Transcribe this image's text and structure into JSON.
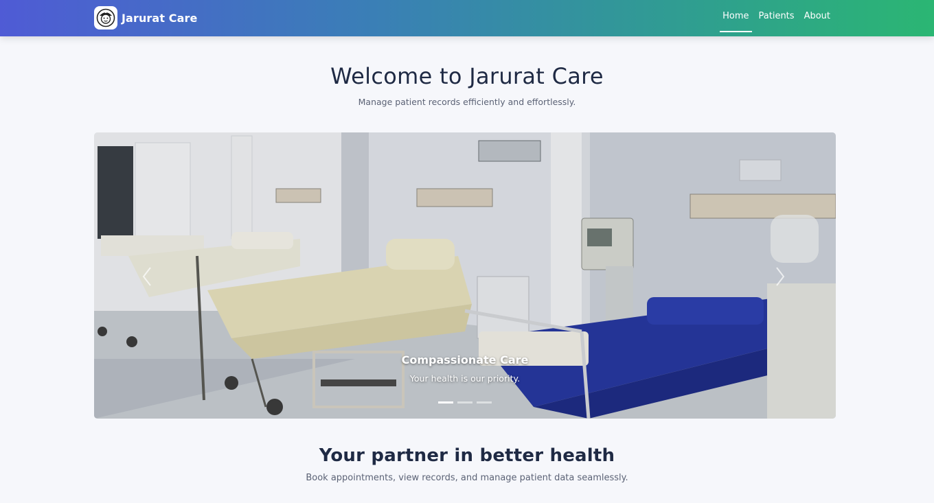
{
  "navbar": {
    "brand_name": "Jarurat Care",
    "brand_logo_icon": "doctor-face-icon",
    "links": [
      {
        "label": "Home",
        "active": true
      },
      {
        "label": "Patients",
        "active": false
      },
      {
        "label": "About",
        "active": false
      }
    ],
    "gradient_colors": [
      "#4f5bd5",
      "#2bb673"
    ]
  },
  "hero": {
    "title": "Welcome to Jarurat Care",
    "subtitle": "Manage patient records efficiently and effortlessly."
  },
  "carousel": {
    "image_icon": "hospital-ward-photo",
    "caption_title": "Compassionate Care",
    "caption_text": "Your health is our priority.",
    "slide_count": 3,
    "active_slide": 1,
    "prev_icon": "chevron-left-icon",
    "next_icon": "chevron-right-icon"
  },
  "section": {
    "title": "Your partner in better health",
    "subtitle": "Book appointments, view records, and manage patient data seamlessly."
  },
  "colors": {
    "background": "#f6f7fb",
    "heading": "#1f2a44",
    "muted_text": "#5b6275"
  }
}
